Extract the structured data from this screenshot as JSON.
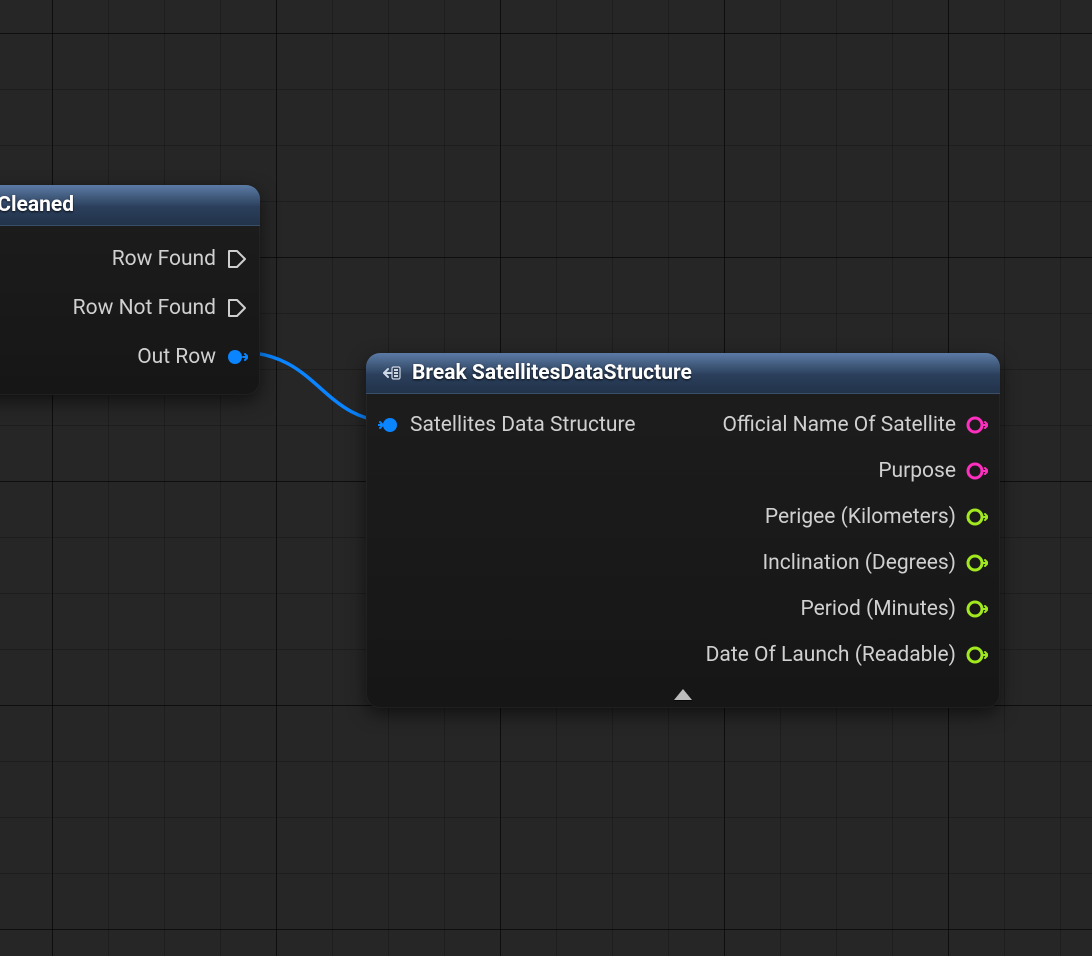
{
  "colors": {
    "struct_pin": "#0a84ff",
    "string_pin": "#ff2fbf",
    "float_pin": "#a2e81f"
  },
  "left_node": {
    "title": "eSatellites_Cleaned",
    "outputs": {
      "row_found": "Row Found",
      "row_not_found": "Row Not Found",
      "out_row": "Out Row"
    }
  },
  "break_node": {
    "title": "Break SatellitesDataStructure",
    "input_label": "Satellites Data Structure",
    "outputs": [
      {
        "label": "Official Name Of Satellite",
        "type": "string"
      },
      {
        "label": "Purpose",
        "type": "string"
      },
      {
        "label": "Perigee (Kilometers)",
        "type": "float"
      },
      {
        "label": "Inclination (Degrees)",
        "type": "float"
      },
      {
        "label": "Period (Minutes)",
        "type": "float"
      },
      {
        "label": "Date Of Launch (Readable)",
        "type": "float"
      }
    ]
  }
}
